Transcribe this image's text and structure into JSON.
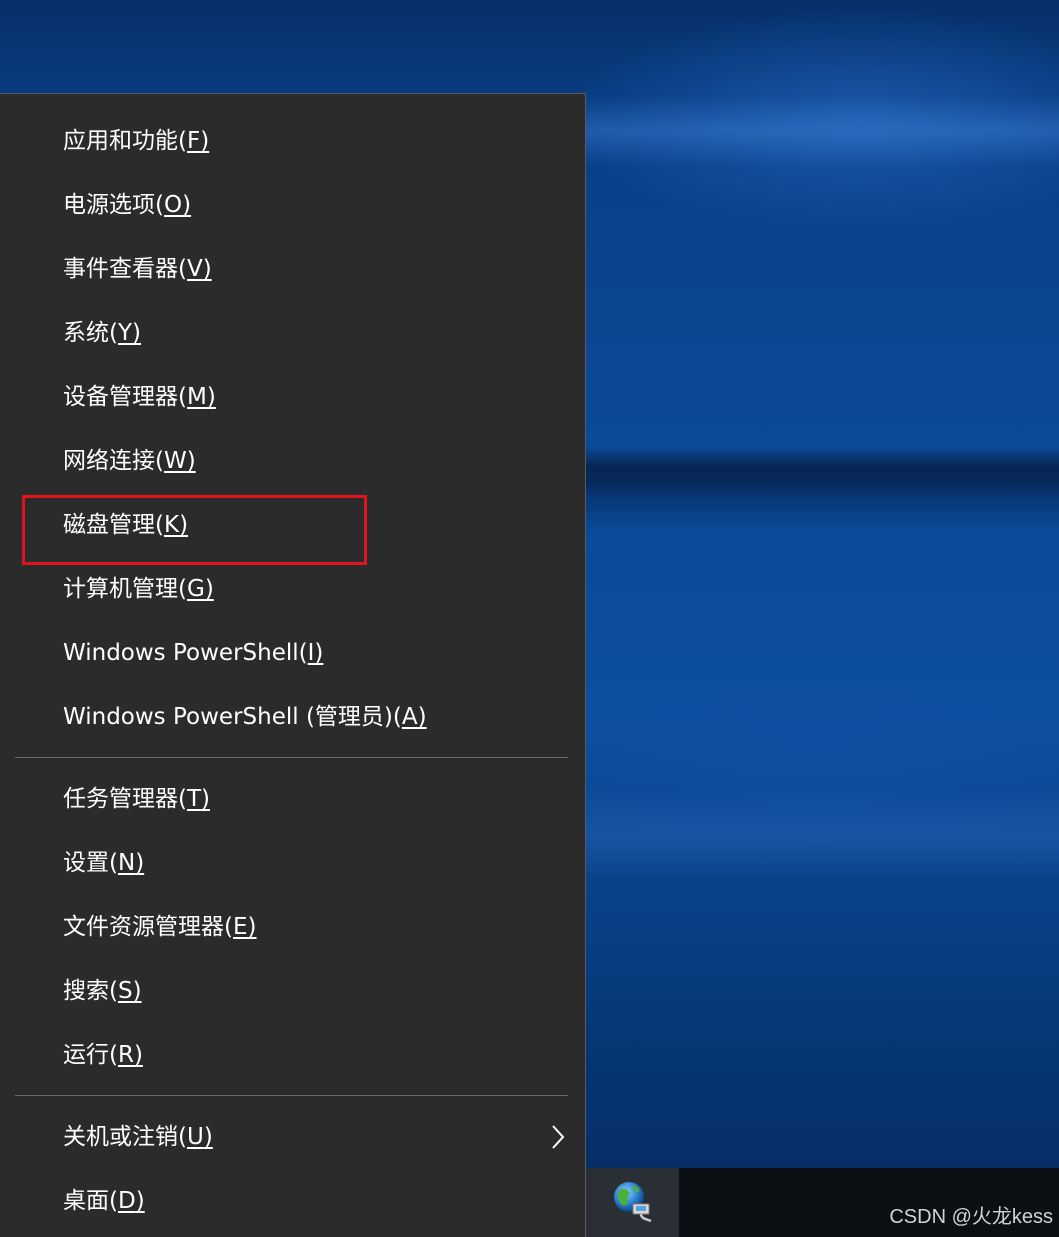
{
  "menu": {
    "groups": [
      {
        "items": [
          {
            "label": "应用和功能(",
            "key": "F",
            "close": ")"
          },
          {
            "label": "电源选项(",
            "key": "O",
            "close": ")"
          },
          {
            "label": "事件查看器(",
            "key": "V",
            "close": ")"
          },
          {
            "label": "系统(",
            "key": "Y",
            "close": ")"
          },
          {
            "label": "设备管理器(",
            "key": "M",
            "close": ")"
          },
          {
            "label": "网络连接(",
            "key": "W",
            "close": ")"
          },
          {
            "label": "磁盘管理(",
            "key": "K",
            "close": ")"
          },
          {
            "label": "计算机管理(",
            "key": "G",
            "close": ")"
          },
          {
            "label": "Windows PowerShell(",
            "key": "I",
            "close": ")"
          },
          {
            "label": "Windows PowerShell (管理员)(",
            "key": "A",
            "close": ")"
          }
        ]
      },
      {
        "items": [
          {
            "label": "任务管理器(",
            "key": "T",
            "close": ")"
          },
          {
            "label": "设置(",
            "key": "N",
            "close": ")"
          },
          {
            "label": "文件资源管理器(",
            "key": "E",
            "close": ")"
          },
          {
            "label": "搜索(",
            "key": "S",
            "close": ")"
          },
          {
            "label": "运行(",
            "key": "R",
            "close": ")"
          }
        ]
      },
      {
        "items": [
          {
            "label": "关机或注销(",
            "key": "U",
            "close": ")",
            "has_submenu": true
          },
          {
            "label": "桌面(",
            "key": "D",
            "close": ")"
          }
        ]
      }
    ],
    "highlighted_item": "磁盘管理(K)"
  },
  "taskbar": {
    "pinned_icon": "network-globe-icon"
  },
  "watermark": "CSDN @火龙kess",
  "colors": {
    "menu_bg": "#2b2b2b",
    "menu_text": "#ffffff",
    "highlight_border": "#e0141e",
    "desktop_blue": "#0b4a97"
  }
}
